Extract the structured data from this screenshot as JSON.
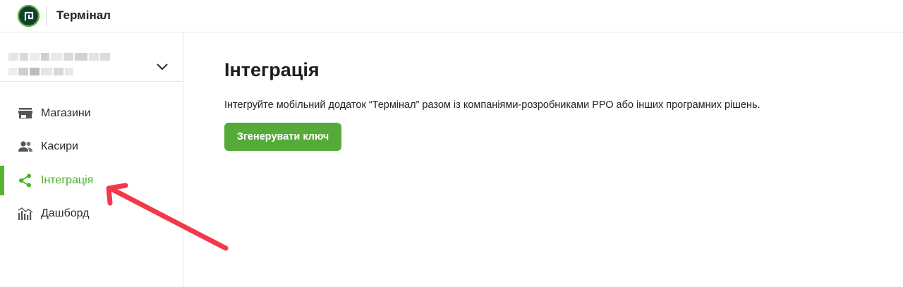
{
  "header": {
    "title": "Термінал",
    "logo_icon": "privat-logo-icon"
  },
  "sidebar": {
    "account": {
      "name_redacted": true,
      "expand_icon": "chevron-down-icon"
    },
    "items": [
      {
        "label": "Магазини",
        "icon": "store-icon",
        "active": false
      },
      {
        "label": "Касири",
        "icon": "people-icon",
        "active": false
      },
      {
        "label": "Інтеграція",
        "icon": "share-icon",
        "active": true
      },
      {
        "label": "Дашборд",
        "icon": "analytics-icon",
        "active": false
      }
    ]
  },
  "main": {
    "title": "Інтеграція",
    "description": "Інтегруйте мобільний додаток “Термінал” разом із компаніями-розробниками РРО або інших програмних рішень.",
    "button_label": "Згенерувати ключ"
  },
  "annotation": {
    "type": "arrow",
    "color": "#f2394b",
    "points_to": "sidebar-item-integration"
  },
  "colors": {
    "accent": "#56ab38",
    "active_text": "#4cae2a",
    "logo_bg": "#1b4e3a"
  }
}
